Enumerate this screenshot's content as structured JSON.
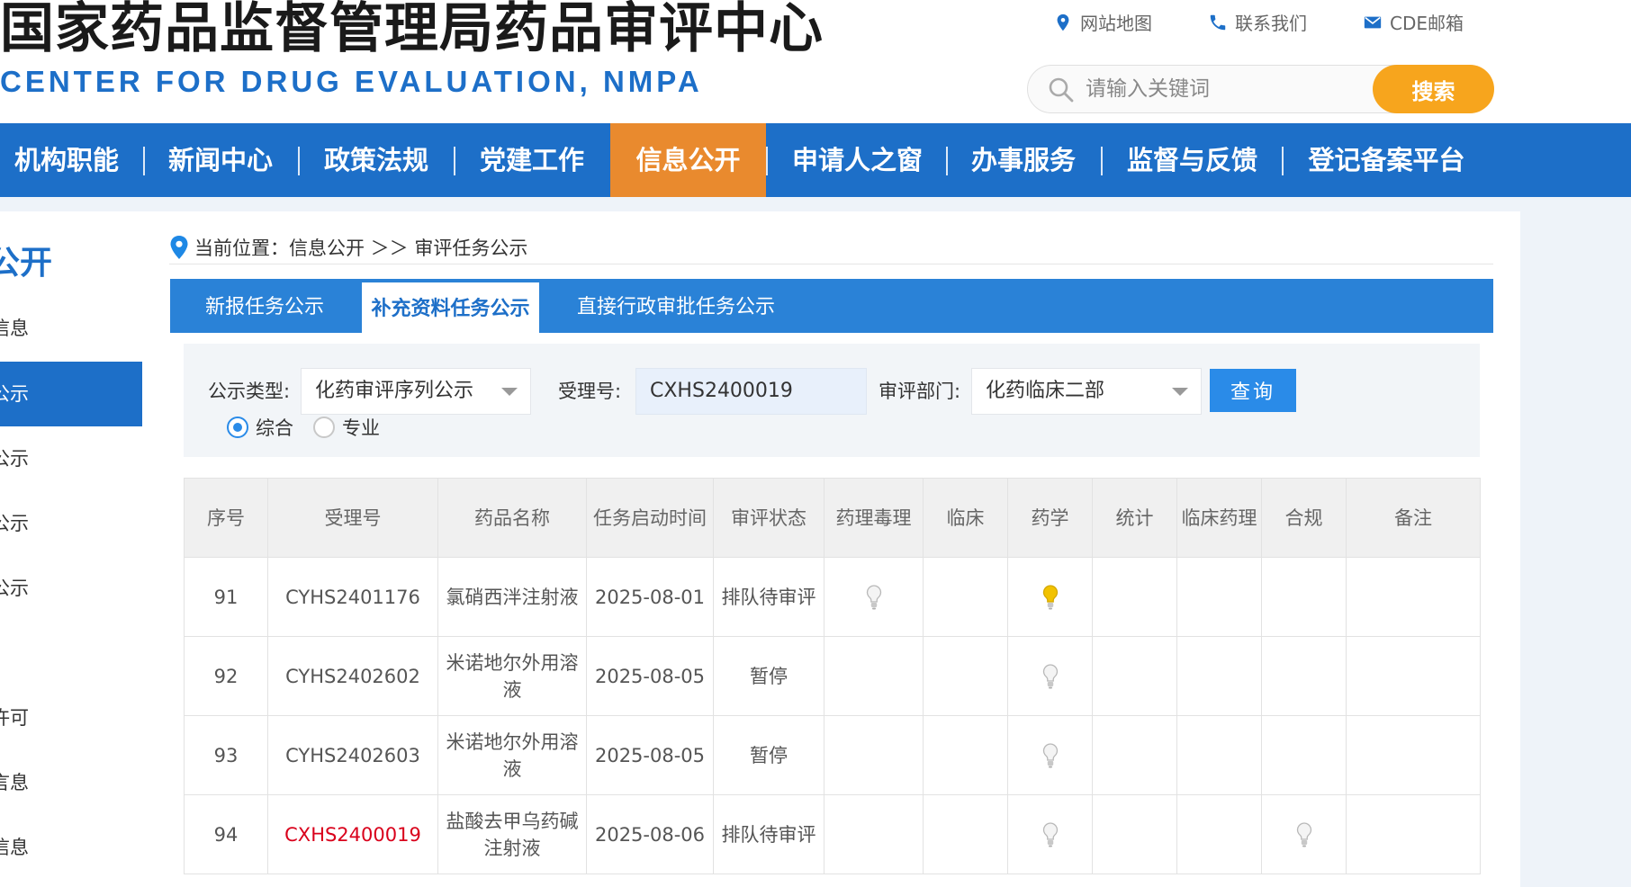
{
  "header": {
    "title": "国家药品监督管理局药品审评中心",
    "subtitle": "CENTER FOR DRUG EVALUATION, NMPA",
    "toplinks": [
      {
        "label": "网站地图",
        "icon": "map-pin-icon"
      },
      {
        "label": "联系我们",
        "icon": "phone-icon"
      },
      {
        "label": "CDE邮箱",
        "icon": "mail-icon"
      }
    ],
    "search": {
      "placeholder": "请输入关键词",
      "button": "搜索"
    }
  },
  "nav": {
    "items": [
      "机构职能",
      "新闻中心",
      "政策法规",
      "党建工作",
      "信息公开",
      "申请人之窗",
      "办事服务",
      "监督与反馈",
      "登记备案平台"
    ],
    "active_index": 4
  },
  "sidebar": {
    "title": "公开",
    "items": [
      "信息",
      "公示",
      "公示",
      "公示",
      "序公示",
      "秋示许可",
      "言息",
      "记信息"
    ],
    "active_index": 1
  },
  "breadcrumb": {
    "text": "当前位置：信息公开 ＞＞ 审评任务公示"
  },
  "tabs": {
    "items": [
      "新报任务公示",
      "补充资料任务公示",
      "直接行政审批任务公示"
    ],
    "active_index": 1
  },
  "filter": {
    "type_label": "公示类型:",
    "type_value": "化药审评序列公示",
    "accept_label": "受理号:",
    "accept_value": "CXHS2400019",
    "dept_label": "审评部门:",
    "dept_value": "化药临床二部",
    "query_button": "查询",
    "radio_options": [
      "综合",
      "专业"
    ],
    "radio_selected": 0
  },
  "table": {
    "headers": [
      "序号",
      "受理号",
      "药品名称",
      "任务启动时间",
      "审评状态",
      "药理毒理",
      "临床",
      "药学",
      "统计",
      "临床药理",
      "合规",
      "备注"
    ],
    "rows": [
      {
        "no": "91",
        "accept": "CYHS2401176",
        "drug": "氯硝西泮注射液",
        "date": "2025-08-01",
        "status": "排队待审评",
        "highlight": false,
        "bulbs": {
          "pharmtox": "grey",
          "pharmacy": "yellow"
        }
      },
      {
        "no": "92",
        "accept": "CYHS2402602",
        "drug": "米诺地尔外用溶液",
        "date": "2025-08-05",
        "status": "暂停",
        "highlight": false,
        "bulbs": {
          "pharmacy": "grey"
        }
      },
      {
        "no": "93",
        "accept": "CYHS2402603",
        "drug": "米诺地尔外用溶液",
        "date": "2025-08-05",
        "status": "暂停",
        "highlight": false,
        "bulbs": {
          "pharmacy": "grey"
        }
      },
      {
        "no": "94",
        "accept": "CXHS2400019",
        "drug": "盐酸去甲乌药碱注射液",
        "date": "2025-08-06",
        "status": "排队待审评",
        "highlight": true,
        "bulbs": {
          "pharmacy": "grey",
          "compliance": "grey"
        }
      }
    ]
  },
  "colors": {
    "brand_blue": "#1d6fc8",
    "nav_active_orange": "#e98a2e",
    "search_orange": "#f7a51d",
    "highlight_red": "#d9001b",
    "bulb_yellow": "#f2c200"
  }
}
